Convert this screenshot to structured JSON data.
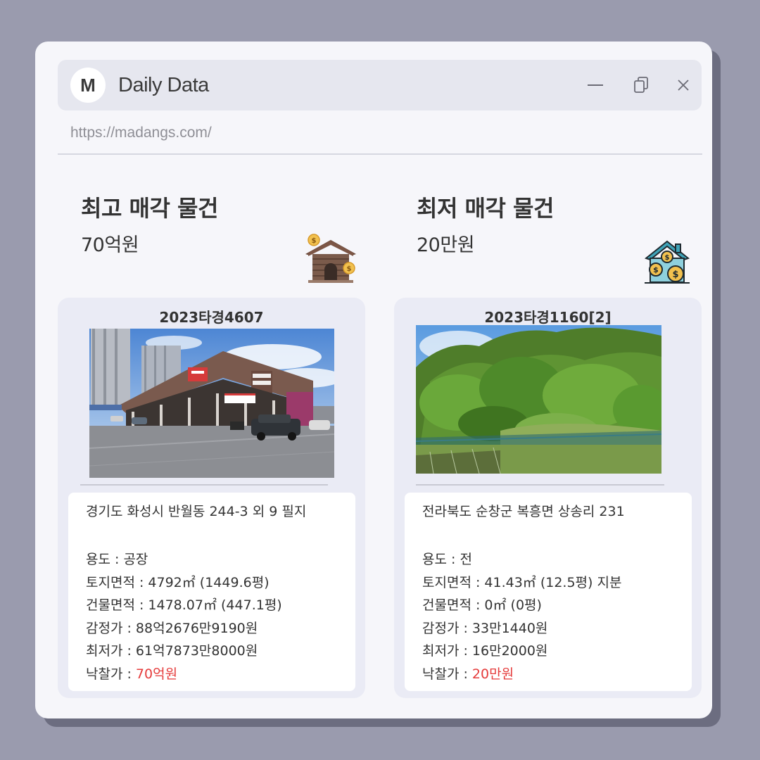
{
  "window": {
    "app_title": "Daily Data",
    "logo_letter": "M",
    "url": "https://madangs.com/"
  },
  "colors": {
    "background": "#9a9bae",
    "window": "#f6f6fa",
    "titlebar": "#e6e7ef",
    "card": "#eaebf5",
    "sold_price": "#e53b3b"
  },
  "highest": {
    "heading": "최고 매각 물건",
    "price": "70억원",
    "icon": "house-with-coins-icon",
    "case_no": "2023타경4607",
    "photo": "factory-photo",
    "address": "경기도 화성시 반월동 244-3 외 9 필지",
    "usage_label": "용도 : ",
    "usage": "공장",
    "land_label": "토지면적 : ",
    "land_area": "4792㎡ (1449.6평)",
    "building_label": "건물면적 : ",
    "building_area": "1478.07㎡ (447.1평)",
    "appraisal_label": "감정가 : ",
    "appraisal": "88억2676만9190원",
    "minimum_label": "최저가 : ",
    "minimum": "61억7873만8000원",
    "sold_label": "낙찰가 : ",
    "sold": "70억원"
  },
  "lowest": {
    "heading": "최저 매각 물건",
    "price": "20만원",
    "icon": "house-with-coins-icon",
    "case_no": "2023타경1160[2]",
    "photo": "field-photo",
    "address": "전라북도 순창군 복흥면 상송리 231",
    "usage_label": "용도 : ",
    "usage": "전",
    "land_label": "토지면적 : ",
    "land_area": "41.43㎡ (12.5평) 지분",
    "building_label": "건물면적 : ",
    "building_area": "0㎡ (0평)",
    "appraisal_label": "감정가 : ",
    "appraisal": "33만1440원",
    "minimum_label": "최저가 : ",
    "minimum": "16만2000원",
    "sold_label": "낙찰가 : ",
    "sold": "20만원"
  }
}
